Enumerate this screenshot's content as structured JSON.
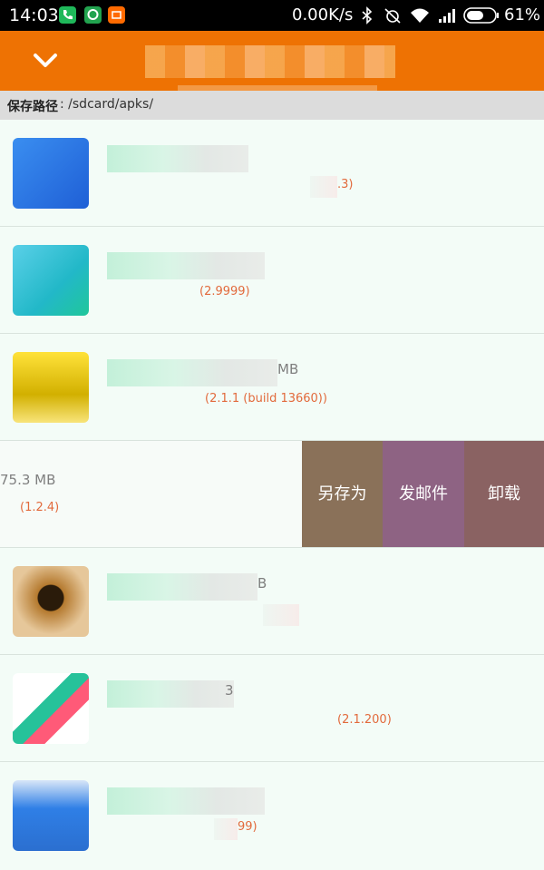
{
  "status_bar": {
    "time": "14:03",
    "net_speed": "0.00K/s",
    "battery": "61%",
    "icons": [
      "phone-app-icon",
      "chat-app-icon",
      "mi-app-icon",
      "bluetooth-icon",
      "alarm-off-icon",
      "wifi-icon",
      "signal-icon",
      "battery-icon"
    ]
  },
  "header": {
    "back_icon": "chevron-down-icon",
    "accent": "#ee7203"
  },
  "path_bar": {
    "label": "保存路径",
    "value": ": /sdcard/apks/"
  },
  "apps": [
    {
      "size": "",
      "version": ".3)"
    },
    {
      "size": "",
      "version": "(2.9999)"
    },
    {
      "size": "MB",
      "version": "(2.1.1 (build 13660))"
    },
    {
      "size": "75.3 MB",
      "version": "(1.2.4)"
    },
    {
      "size": "B",
      "version": ""
    },
    {
      "size": "3",
      "version": "(2.1.200)"
    },
    {
      "size": "",
      "version": "99)"
    }
  ],
  "swipe_actions": {
    "save_as": "另存为",
    "email": "发邮件",
    "uninstall": "卸载"
  },
  "colors": {
    "save_as_bg": "#8a7159",
    "email_bg": "#8e6383",
    "uninstall_bg": "#8a6262",
    "list_bg": "#f3fcf7",
    "version_text": "#e26a3c"
  }
}
